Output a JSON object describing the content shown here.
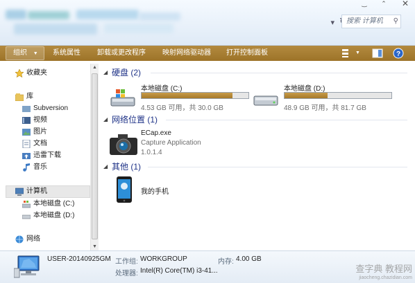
{
  "search": {
    "placeholder": "搜索 计算机"
  },
  "toolbar": {
    "organize": "组织",
    "items": [
      "系统属性",
      "卸载或更改程序",
      "映射网络驱动器",
      "打开控制面板"
    ]
  },
  "nav": {
    "favorites": "收藏夹",
    "libraries": "库",
    "library_items": [
      "Subversion",
      "视频",
      "图片",
      "文档",
      "迅雷下载",
      "音乐"
    ],
    "computer": "计算机",
    "computer_items": [
      "本地磁盘 (C:)",
      "本地磁盘 (D:)"
    ],
    "network": "网络"
  },
  "groups": {
    "drives": {
      "title": "硬盘 (2)"
    },
    "network": {
      "title": "网络位置 (1)"
    },
    "other": {
      "title": "其他 (1)"
    }
  },
  "drives": [
    {
      "name": "本地磁盘 (C:)",
      "free_text": "4.53 GB 可用，共 30.0 GB",
      "used_fraction": 0.849
    },
    {
      "name": "本地磁盘 (D:)",
      "free_text": "48.9 GB 可用，共 81.7 GB",
      "used_fraction": 0.401
    }
  ],
  "network_item": {
    "name": "ECap.exe",
    "desc": "Capture Application",
    "version": "1.0.1.4"
  },
  "other_item": {
    "name": "我的手机"
  },
  "details": {
    "computer_name": "USER-20140925GM",
    "workgroup_label": "工作组:",
    "workgroup": "WORKGROUP",
    "memory_label": "内存:",
    "memory": "4.00 GB",
    "cpu_label": "处理器:",
    "cpu": "Intel(R) Core(TM) i3-41..."
  },
  "watermark": {
    "line1": "查字典 教程网",
    "line2": "jiaocheng.chazidian.com"
  },
  "colors": {
    "toolbar": "#a77d30",
    "drive_bar": "#b68b3c",
    "group_header": "#1e3287"
  }
}
